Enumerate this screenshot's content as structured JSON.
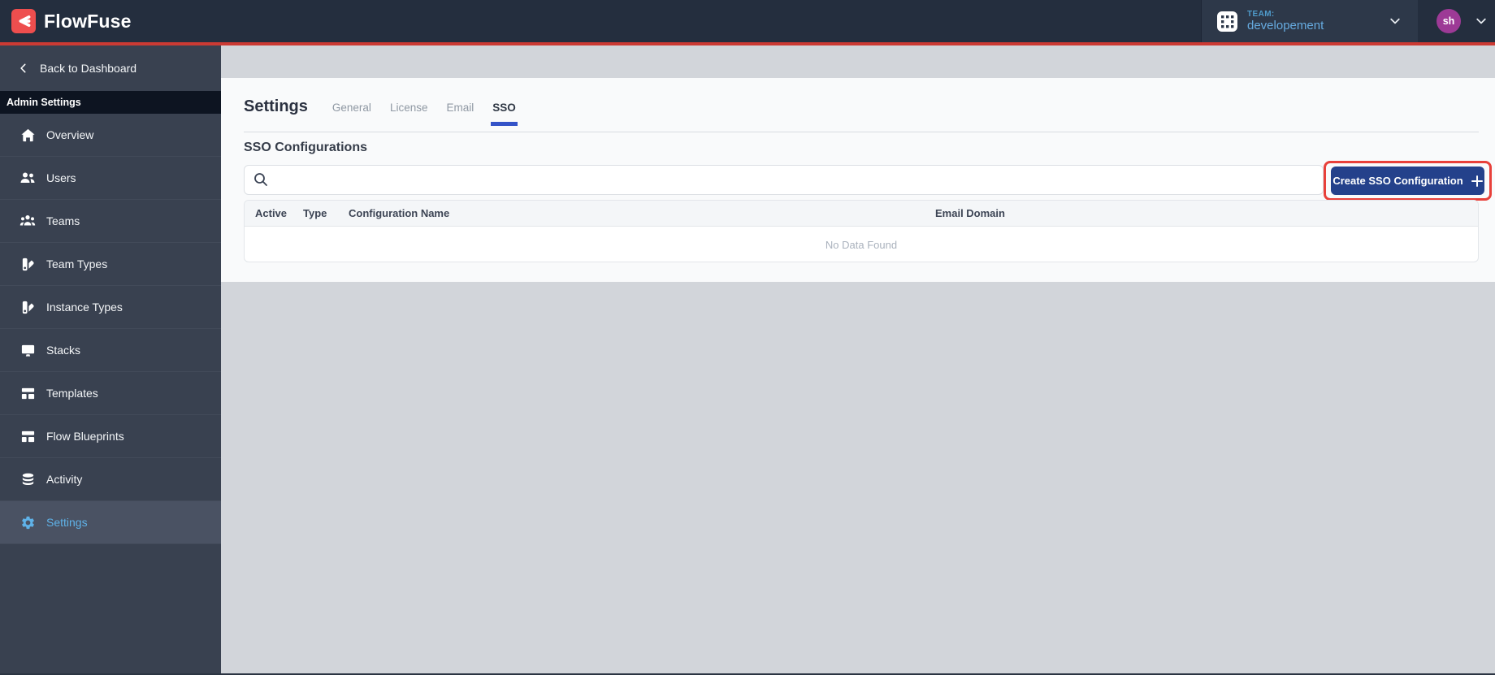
{
  "navbar": {
    "brand": "FlowFuse",
    "team": {
      "label": "TEAM:",
      "name": "developement"
    },
    "avatar": {
      "initials": "sh"
    }
  },
  "sidebar": {
    "back_label": "Back to Dashboard",
    "section_label": "Admin Settings",
    "items": [
      {
        "label": "Overview",
        "icon": "overview-icon",
        "active": false
      },
      {
        "label": "Users",
        "icon": "users-icon",
        "active": false
      },
      {
        "label": "Teams",
        "icon": "teams-icon",
        "active": false
      },
      {
        "label": "Team Types",
        "icon": "swatch-icon",
        "active": false
      },
      {
        "label": "Instance Types",
        "icon": "swatch-icon",
        "active": false
      },
      {
        "label": "Stacks",
        "icon": "desktop-icon",
        "active": false
      },
      {
        "label": "Templates",
        "icon": "template-icon",
        "active": false
      },
      {
        "label": "Flow Blueprints",
        "icon": "template-icon",
        "active": false
      },
      {
        "label": "Activity",
        "icon": "database-icon",
        "active": false
      },
      {
        "label": "Settings",
        "icon": "gear-icon",
        "active": true
      }
    ]
  },
  "main": {
    "title": "Settings",
    "tabs": [
      {
        "label": "General",
        "active": false
      },
      {
        "label": "License",
        "active": false
      },
      {
        "label": "Email",
        "active": false
      },
      {
        "label": "SSO",
        "active": true
      }
    ],
    "active_tab": "SSO",
    "section_title": "SSO Configurations",
    "search": {
      "value": "",
      "placeholder": ""
    },
    "create_button_label": "Create SSO Configuration",
    "table": {
      "headers": [
        "Active",
        "Type",
        "Configuration Name",
        "Email Domain"
      ],
      "rows": [],
      "empty_text": "No Data Found"
    }
  },
  "colors": {
    "navbar_bg": "#242e3e",
    "accent_red": "#cc3a33",
    "logo_red": "#ee4e4e",
    "team_bg": "#2d3849",
    "team_text": "#66abe0",
    "avatar_bg": "#9d3a96",
    "sidebar_bg": "#394150",
    "sidebar_active_bg": "#4a5263",
    "sidebar_active_text": "#5fb2e8",
    "admin_band_bg": "#0d1421",
    "content_bg": "#f9fafb",
    "page_gray": "#d2d5da",
    "tab_underline": "#3453c8",
    "button_bg": "#24418b",
    "highlight_red": "#e8403a"
  }
}
